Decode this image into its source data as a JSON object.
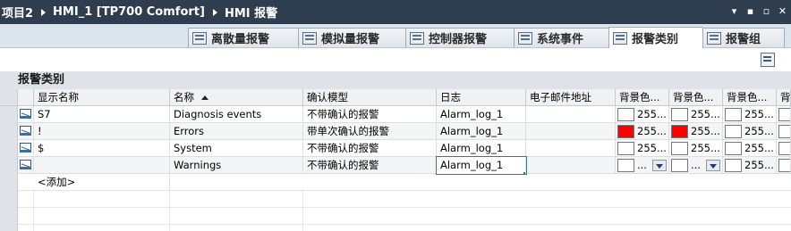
{
  "title": {
    "crumbs": [
      "项目2",
      "HMI_1 [TP700 Comfort]",
      "HMI 报警"
    ],
    "controls": [
      "▾",
      "▪",
      "▫",
      "✕"
    ]
  },
  "tabs": [
    {
      "label": "离散量报警",
      "active": false
    },
    {
      "label": "模拟量报警",
      "active": false
    },
    {
      "label": "控制器报警",
      "active": false
    },
    {
      "label": "系统事件",
      "active": false
    },
    {
      "label": "报警类别",
      "active": true
    },
    {
      "label": "报警组",
      "active": false
    }
  ],
  "section_title": "报警类别",
  "columns": [
    "显示名称",
    "名称",
    "确认模型",
    "日志",
    "电子邮件地址",
    "背景色...",
    "背景色...",
    "背景色...",
    "背"
  ],
  "rows": [
    {
      "display_name": "S7",
      "name": "Diagnosis events",
      "ack_model": "不带确认的报警",
      "log": "Alarm_log_1",
      "email": "",
      "bg1": "255...",
      "bg2": "255...",
      "bg3": "255...",
      "bg1_color": "#ffffff",
      "bg2_color": "#ffffff",
      "bg3_color": "#ffffff"
    },
    {
      "display_name": "!",
      "name": "Errors",
      "ack_model": "带单次确认的报警",
      "log": "Alarm_log_1",
      "email": "",
      "bg1": "255...",
      "bg2": "255...",
      "bg3": "255...",
      "bg1_color": "#ff0000",
      "bg2_color": "#ff0000",
      "bg3_color": "#ffffff"
    },
    {
      "display_name": "$",
      "name": "System",
      "ack_model": "不带确认的报警",
      "log": "Alarm_log_1",
      "email": "",
      "bg1": "255...",
      "bg2": "255...",
      "bg3": "255...",
      "bg1_color": "#ffffff",
      "bg2_color": "#ffffff",
      "bg3_color": "#ffffff"
    },
    {
      "display_name": "",
      "name": "Warnings",
      "ack_model": "不带确认的报警",
      "log": "Alarm_log_1",
      "email": "",
      "bg1": "...",
      "bg2": "...",
      "bg3": "255...",
      "bg1_color": "#ffffff",
      "bg2_color": "#ffffff",
      "bg3_color": "#ffffff"
    }
  ],
  "add_label": "<添加>"
}
